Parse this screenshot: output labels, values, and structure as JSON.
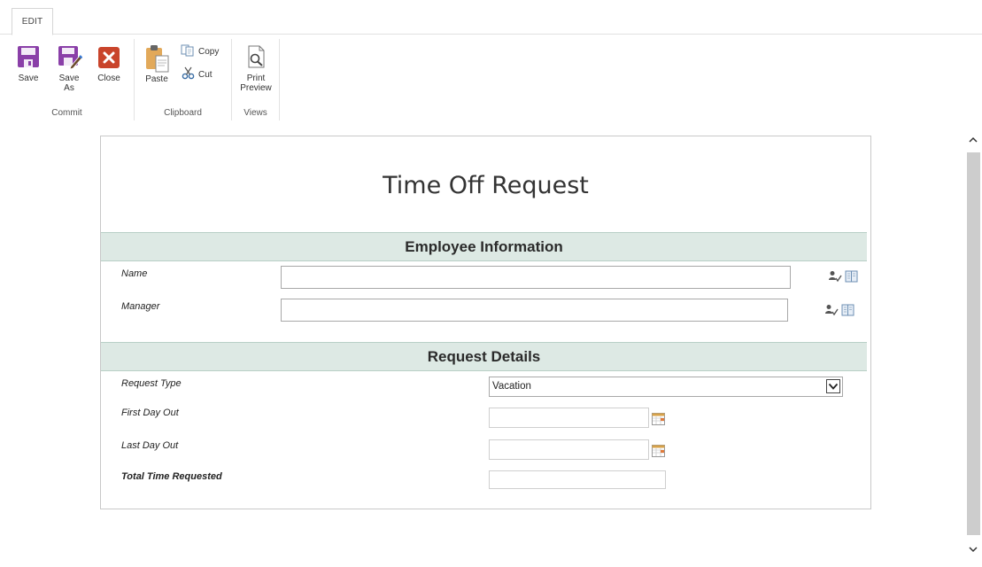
{
  "ribbon": {
    "tab": "EDIT",
    "commit": {
      "label": "Commit",
      "save": "Save",
      "save_as_1": "Save",
      "save_as_2": "As",
      "close": "Close"
    },
    "clipboard": {
      "label": "Clipboard",
      "paste": "Paste",
      "copy": "Copy",
      "cut": "Cut"
    },
    "views": {
      "label": "Views",
      "print_preview_1": "Print",
      "print_preview_2": "Preview"
    }
  },
  "form": {
    "title": "Time Off Request",
    "employee_section": "Employee Information",
    "name_label": "Name",
    "name_value": "",
    "manager_label": "Manager",
    "manager_value": "",
    "request_section": "Request Details",
    "request_type_label": "Request Type",
    "request_type_value": "Vacation",
    "first_day_label": "First Day Out",
    "first_day_value": "",
    "last_day_label": "Last Day Out",
    "last_day_value": "",
    "total_time_label": "Total Time Requested",
    "total_time_value": ""
  },
  "colors": {
    "save_purple": "#8a3fa8",
    "close_red": "#c9442b",
    "section_bg": "#dde9e4"
  },
  "icons": [
    "save-icon",
    "save-as-icon",
    "close-icon",
    "paste-icon",
    "copy-icon",
    "cut-icon",
    "print-preview-icon",
    "people-picker-icon",
    "address-book-icon",
    "calendar-icon",
    "dropdown-arrow-icon",
    "scroll-up-icon",
    "scroll-down-icon"
  ]
}
